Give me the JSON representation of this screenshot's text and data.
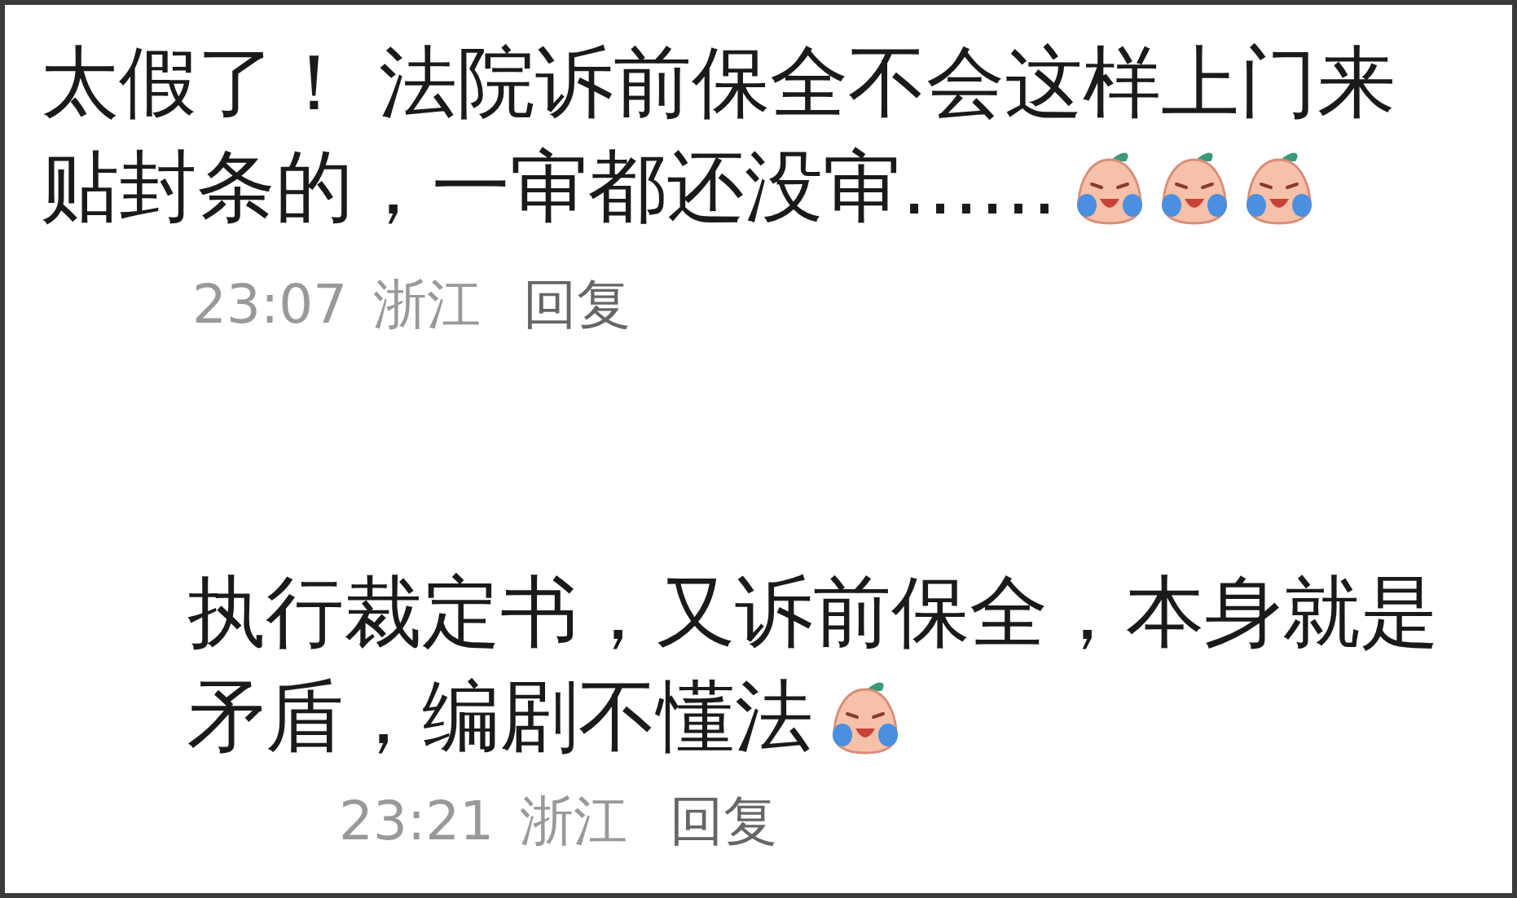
{
  "comments": [
    {
      "lines": [
        "太假了！ 法院诉前保全不会这样上门来",
        "贴封条的，一审都还没审……"
      ],
      "emojis": [
        {
          "kind": "crying"
        },
        {
          "kind": "crying"
        },
        {
          "kind": "crying"
        }
      ],
      "time": "23:07",
      "location": "浙江",
      "reply": "回复"
    },
    {
      "lines": [
        "执行裁定书，又诉前保全，本身就是",
        "矛盾，编剧不懂法"
      ],
      "emojis": [
        {
          "kind": "crying"
        }
      ],
      "time": "23:21",
      "location": "浙江",
      "reply": "回复"
    }
  ]
}
